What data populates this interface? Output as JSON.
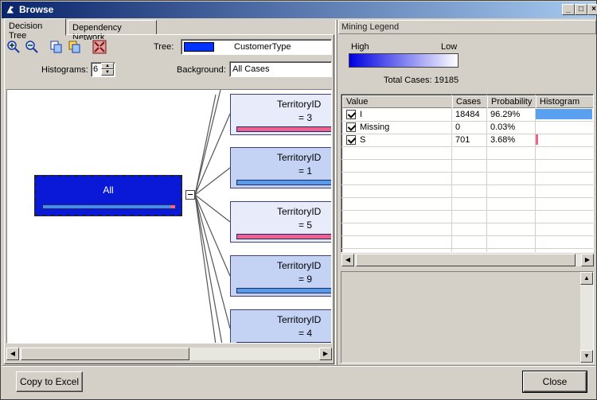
{
  "window": {
    "title": "Browse"
  },
  "tabs": [
    {
      "label": "Decision Tree",
      "active": true
    },
    {
      "label": "Dependency Network",
      "active": false
    }
  ],
  "toolbar": {
    "icons": [
      "zoom-in-icon",
      "zoom-out-icon",
      "copy-graph-icon",
      "copy-view-icon",
      "size-to-fit-icon"
    ],
    "tree_label": "Tree:",
    "tree_value": "CustomerType",
    "tree_color": "#0033ff",
    "histograms_label": "Histograms:",
    "histograms_value": "6",
    "background_label": "Background:",
    "background_value": "All Cases"
  },
  "tree": {
    "root": {
      "label": "All",
      "color": "#0a18d8",
      "histogram": {
        "i_fraction": 0.9629,
        "s_fraction": 0.0368
      }
    },
    "children": [
      {
        "title": "TerritoryID",
        "value": "= 3",
        "bar": "pink"
      },
      {
        "title": "TerritoryID",
        "value": "= 1",
        "bar": "blue"
      },
      {
        "title": "TerritoryID",
        "value": "= 5",
        "bar": "pink"
      },
      {
        "title": "TerritoryID",
        "value": "= 9",
        "bar": "blue"
      },
      {
        "title": "TerritoryID",
        "value": "= 4",
        "bar": "blue"
      }
    ]
  },
  "legend": {
    "header": "Mining Legend",
    "high_label": "High",
    "low_label": "Low",
    "total_cases": "Total Cases: 19185",
    "columns": [
      "Value",
      "Cases",
      "Probability",
      "Histogram"
    ],
    "rows": [
      {
        "value": "I",
        "cases": "18484",
        "probability": "96.29%",
        "hist_fraction": 0.9629,
        "hist_color": "#5aa0f0"
      },
      {
        "value": "Missing",
        "cases": "0",
        "probability": "0.03%",
        "hist_fraction": 0.0003,
        "hist_color": "#5aa0f0"
      },
      {
        "value": "S",
        "cases": "701",
        "probability": "3.68%",
        "hist_fraction": 0.0368,
        "hist_color": "#f06090"
      }
    ]
  },
  "buttons": {
    "copy_to_excel": "Copy to Excel",
    "close": "Close"
  }
}
